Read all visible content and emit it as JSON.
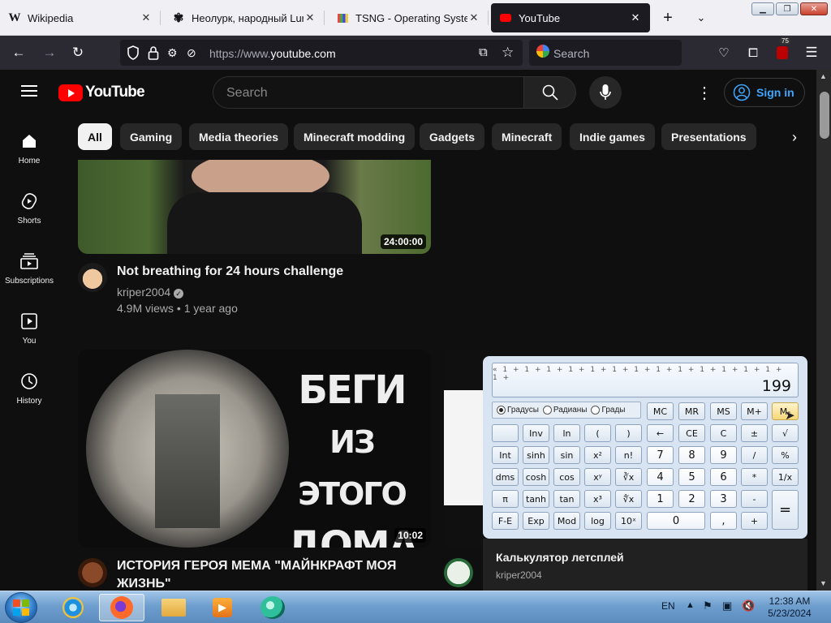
{
  "browser": {
    "tabs": [
      {
        "title": "Wikipedia",
        "favicon": "W",
        "active": false
      },
      {
        "title": "Неолурк, народный Lurkmore",
        "favicon": "neolurk",
        "active": false
      },
      {
        "title": "TSNG - Operating Systems",
        "favicon": "tsng",
        "active": false
      },
      {
        "title": "YouTube",
        "favicon": "youtube",
        "active": true
      }
    ],
    "url_protocol": "https://www.",
    "url_host": "youtube.com",
    "search_placeholder": "Search",
    "extension_badge": "75"
  },
  "youtube": {
    "logo_text": "YouTube",
    "search_placeholder": "Search",
    "sign_in_label": "Sign in",
    "sidebar": [
      {
        "label": "Home",
        "icon": "home-icon"
      },
      {
        "label": "Shorts",
        "icon": "shorts-icon"
      },
      {
        "label": "Subscriptions",
        "icon": "subscriptions-icon"
      },
      {
        "label": "You",
        "icon": "you-icon"
      },
      {
        "label": "History",
        "icon": "history-icon"
      }
    ],
    "chips": [
      "All",
      "Gaming",
      "Media theories",
      "Minecraft modding",
      "Gadgets",
      "Minecraft",
      "Indie games",
      "Presentations"
    ],
    "videos": [
      {
        "title": "Not breathing for 24 hours challenge",
        "channel": "kriper2004",
        "meta": "4.9M views • 1 year ago",
        "duration": "24:00:00"
      },
      {
        "title_line1": "ИСТОРИЯ ГЕРОЯ МЕМА \"МАЙНКРАФТ МОЯ",
        "title_line2": "ЖИЗНЬ\"",
        "duration": "10:02",
        "thumb_text": [
          "БЕГИ",
          "ИЗ ЭТОГО",
          "ДОМА"
        ]
      },
      {
        "title": "Калькулятор летсплей",
        "channel": "kriper2004"
      }
    ]
  },
  "calculator": {
    "expression": "« 1 + 1 + 1 + 1 + 1 + 1 + 1 + 1 + 1 + 1 + 1 + 1 + 1 + 1 +",
    "result": "199",
    "modes": [
      "Градусы",
      "Радианы",
      "Грады"
    ],
    "mem": [
      "MC",
      "MR",
      "MS",
      "M+",
      "M-"
    ],
    "row1": [
      "",
      "Inv",
      "ln",
      "(",
      ")",
      "←",
      "CE",
      "C",
      "±",
      "√"
    ],
    "row2": [
      "Int",
      "sinh",
      "sin",
      "x²",
      "n!",
      "7",
      "8",
      "9",
      "/",
      "%"
    ],
    "row3": [
      "dms",
      "cosh",
      "cos",
      "xʸ",
      "∛x",
      "4",
      "5",
      "6",
      "*",
      "1/x"
    ],
    "row4": [
      "π",
      "tanh",
      "tan",
      "x³",
      "∜x",
      "1",
      "2",
      "3",
      "-",
      "="
    ],
    "row5": [
      "F-E",
      "Exp",
      "Mod",
      "log",
      "10ˣ",
      "0",
      ",",
      "+"
    ]
  },
  "taskbar": {
    "language": "EN",
    "time": "12:38 AM",
    "date": "5/23/2024"
  }
}
